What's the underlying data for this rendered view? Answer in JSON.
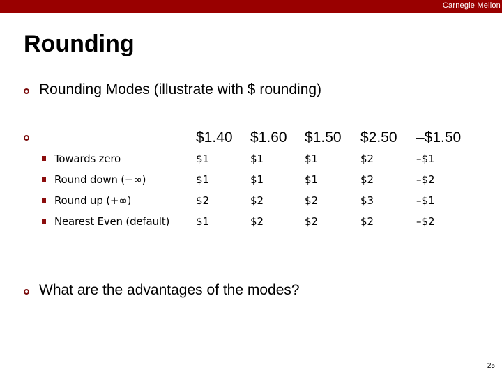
{
  "header": {
    "org": "Carnegie Mellon",
    "bar_color": "#990000"
  },
  "slide": {
    "title": "Rounding",
    "bullets": [
      {
        "text": "Rounding Modes (illustrate with $ rounding)"
      },
      {
        "text": ""
      },
      {
        "text": "What are the advantages of the modes?"
      }
    ],
    "table": {
      "columns": [
        "$1.40",
        "$1.60",
        "$1.50",
        "$2.50",
        "–$1.50"
      ],
      "rows": [
        {
          "mode": "Towards zero",
          "values": [
            "$1",
            "$1",
            "$1",
            "$2",
            "–$1"
          ]
        },
        {
          "mode": "Round down (−∞)",
          "values": [
            "$1",
            "$1",
            "$1",
            "$2",
            "–$2"
          ]
        },
        {
          "mode": "Round up (+∞)",
          "values": [
            "$2",
            "$2",
            "$2",
            "$3",
            "–$1"
          ]
        },
        {
          "mode": "Nearest Even (default)",
          "values": [
            "$1",
            "$2",
            "$2",
            "$2",
            "–$2"
          ]
        }
      ]
    },
    "page_number": "25"
  },
  "colors": {
    "accent": "#990000",
    "bullet": "#7a0c0c"
  }
}
